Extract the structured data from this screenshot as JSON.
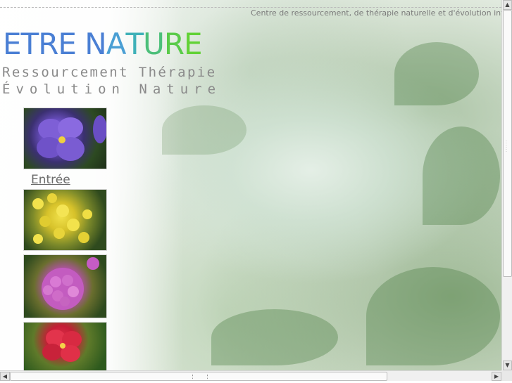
{
  "header": {
    "tagline": "Centre de ressourcement, de thérapie naturelle et d'évolution intérieure"
  },
  "logo": {
    "text": "ETRE NATURE",
    "letters": [
      {
        "ch": "E",
        "color": "#4a7fd4"
      },
      {
        "ch": "T",
        "color": "#4a7fd4"
      },
      {
        "ch": "R",
        "color": "#4a7fd4"
      },
      {
        "ch": "E",
        "color": "#4a7fd4"
      },
      {
        "ch": " ",
        "color": "#4a7fd4"
      },
      {
        "ch": "N",
        "color": "#4a7fd4"
      },
      {
        "ch": "A",
        "color": "#4a9fd4"
      },
      {
        "ch": "T",
        "color": "#3fb1b8"
      },
      {
        "ch": "U",
        "color": "#4cbf7a"
      },
      {
        "ch": "R",
        "color": "#5acb4a"
      },
      {
        "ch": "E",
        "color": "#62d236"
      }
    ]
  },
  "subtitle": {
    "line1": "Ressourcement Thérapie",
    "line2": "Évolution Nature"
  },
  "nav": {
    "entry_label": "Entrée"
  },
  "thumbnails": [
    {
      "subject": "purple-pansy"
    },
    {
      "subject": "yellow-mimosa"
    },
    {
      "subject": "pink-hydrangea"
    },
    {
      "subject": "red-hibiscus"
    }
  ],
  "scrollbars": {
    "up_arrow": "▲",
    "down_arrow": "▼",
    "left_arrow": "◀",
    "right_arrow": "▶"
  }
}
